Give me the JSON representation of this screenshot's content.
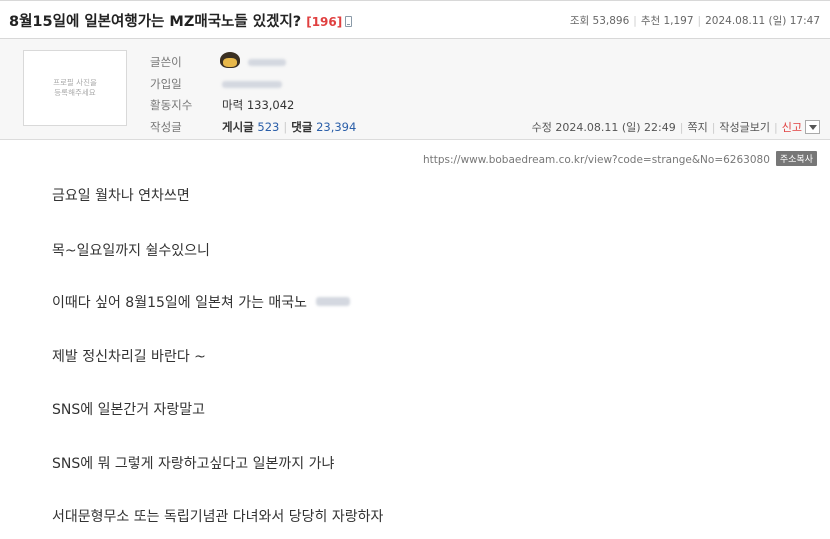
{
  "post": {
    "title": "8월15일에 일본여행가는 MZ매국노들 있겠지?",
    "comment_count": "[196]",
    "views_label": "조회 53,896",
    "recommend_label": "추천 1,197",
    "date": "2024.08.11 (일) 17:47"
  },
  "author": {
    "profile_placeholder_line1": "프로필 사진을",
    "profile_placeholder_line2": "등록해주세요",
    "writer_label": "글쓴이",
    "joined_label": "가입일",
    "activity_label": "활동지수",
    "activity_value": "마력 133,042",
    "posts_label": "작성글",
    "posts_key": "게시글",
    "posts_count": "523",
    "comments_key": "댓글",
    "comments_count": "23,394"
  },
  "edit": {
    "modified": "수정 2024.08.11 (일) 22:49",
    "message": "쪽지",
    "view_posts": "작성글보기",
    "report": "신고"
  },
  "url": {
    "text": "https://www.bobaedream.co.kr/view?code=strange&No=6263080",
    "copy_button": "주소복사"
  },
  "body": [
    "금요일 월차나 연차쓰면",
    "목~일요일까지 쉴수있으니",
    "이때다 싶어 8월15일에 일본쳐 가는 매국노",
    "제발 정신차리길 바란다 ~",
    "SNS에 일본간거 자랑말고",
    "SNS에 뭐 그렇게 자랑하고싶다고 일본까지 가냐",
    "서대문형무소 또는 독립기념관 다녀와서 당당히 자랑하자"
  ],
  "colors": {
    "accent_red": "#e04040",
    "link_blue": "#2a5ea8"
  }
}
